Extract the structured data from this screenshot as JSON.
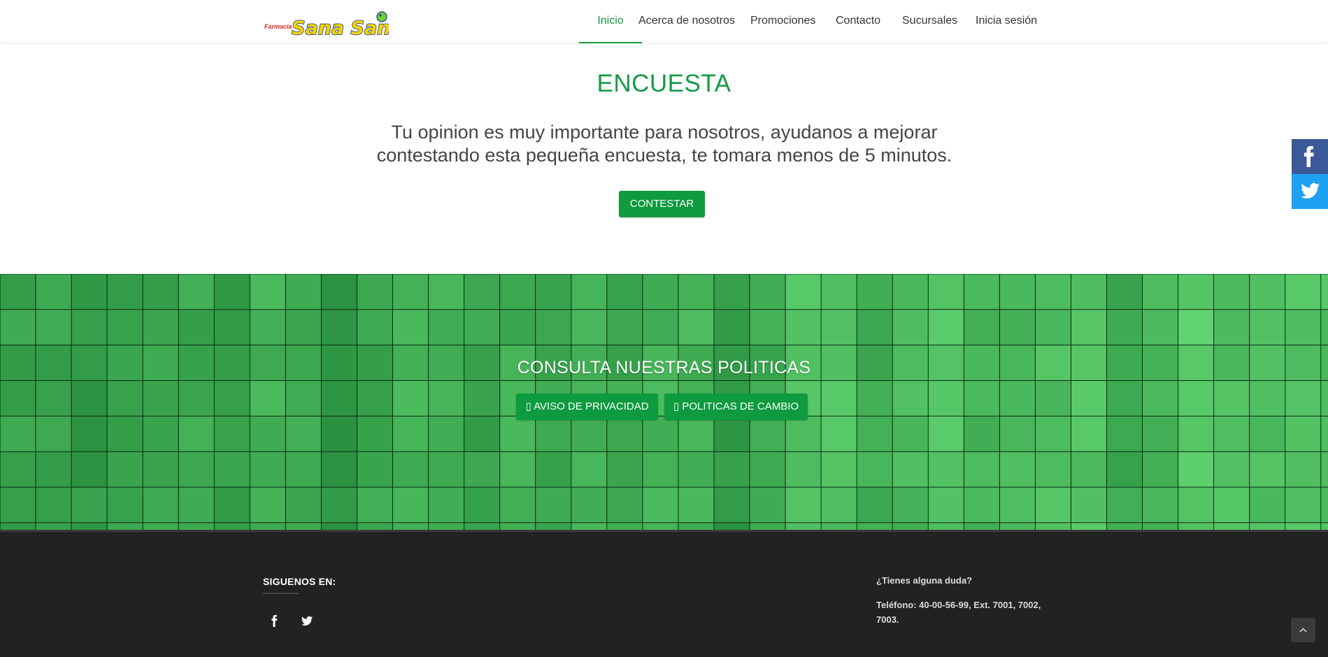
{
  "brand": {
    "logo_small_text": "Farmacia",
    "logo_text": "Sana Sana"
  },
  "nav": {
    "items": [
      "Inicio",
      "Acerca de nosotros",
      "Promociones",
      "Contacto",
      "Sucursales",
      "Inicia sesión"
    ],
    "active": "Inicio"
  },
  "survey": {
    "title": "ENCUESTA",
    "line1": "Tu opinion es muy importante para nosotros, ayudanos a mejorar",
    "line2": "contestando esta pequeña encuesta, te tomara menos de 5 minutos.",
    "button": "CONTESTAR"
  },
  "policies": {
    "title": "CONSULTA NUESTRAS POLITICAS",
    "privacy_button": "AVISO DE PRIVACIDAD",
    "changes_button": "POLITICAS DE CAMBIO",
    "button_icon_glyph": "▯"
  },
  "footer": {
    "follow_heading": "SIGUENOS EN:",
    "question": "¿Tienes alguna duda?",
    "phone_line1": "Teléfono: 40-00-56-99, Ext. 7001, 7002,",
    "phone_line2": "7003."
  },
  "colors": {
    "accent": "#169b46",
    "button": "#0e9a3e",
    "footer": "#222222",
    "facebook": "#3b5998",
    "twitter": "#1da1f2"
  },
  "icons": {
    "side": [
      "facebook-icon",
      "twitter-icon"
    ],
    "footer": [
      "facebook-icon",
      "twitter-icon"
    ],
    "scroll": "chevron-up-icon"
  }
}
